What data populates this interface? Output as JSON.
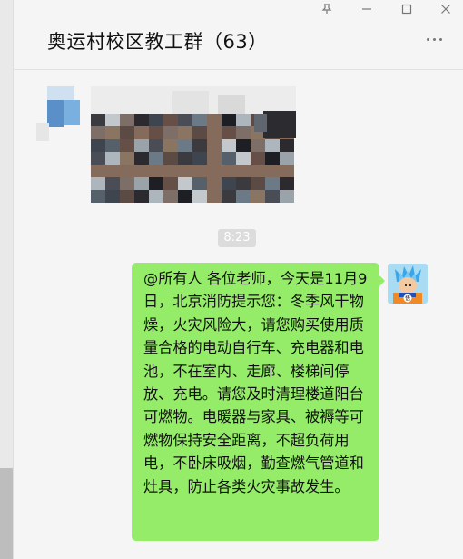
{
  "window": {
    "controls": {
      "pin_icon": "pin-icon",
      "minimize_icon": "minimize-icon",
      "maximize_icon": "maximize-icon",
      "close_icon": "close-icon"
    }
  },
  "chat": {
    "title": "奥运村校区教工群（63）",
    "more_icon": "more-icon"
  },
  "messages": [
    {
      "type": "image",
      "content": "blurred-photo"
    },
    {
      "type": "timestamp",
      "text": "8:23"
    },
    {
      "type": "text",
      "sender": "self",
      "text": "@所有人 各位老师，今天是11月9日，北京消防提示您：冬季风干物燥，火灾风险大，请您购买使用质量合格的电动自行车、充电器和电池，不在室内、走廊、楼梯间停放、充电。请您及时清理楼道阳台可燃物。电暖器与家具、被褥等可燃物保持安全距离，不超负荷用电，不卧床吸烟，勤查燃气管道和灶具，防止各类火灾事故发生。"
    }
  ],
  "colors": {
    "bubble": "#95ec69",
    "background": "#f5f5f5"
  }
}
